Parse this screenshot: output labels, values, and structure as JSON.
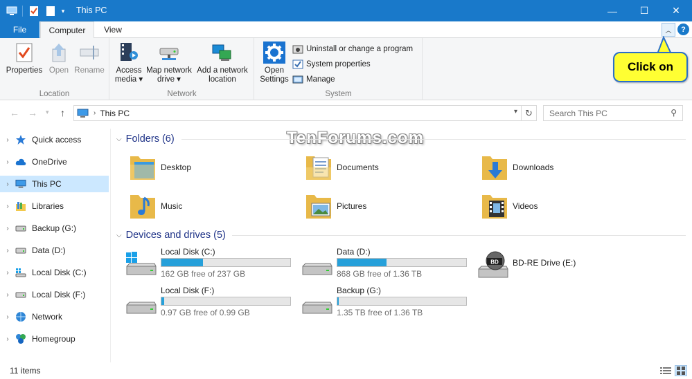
{
  "window": {
    "title": "This PC",
    "minimize_glyph": "—",
    "maximize_glyph": "☐",
    "close_glyph": "✕"
  },
  "ribbon_tabs": {
    "file": "File",
    "computer": "Computer",
    "view": "View"
  },
  "ribbon": {
    "location": {
      "label": "Location",
      "properties": "Properties",
      "open": "Open",
      "rename": "Rename"
    },
    "network": {
      "label": "Network",
      "access_media_line1": "Access",
      "access_media_line2": "media ▾",
      "map_drive_line1": "Map network",
      "map_drive_line2": "drive ▾",
      "add_location_line1": "Add a network",
      "add_location_line2": "location"
    },
    "system": {
      "label": "System",
      "open_settings_line1": "Open",
      "open_settings_line2": "Settings",
      "uninstall": "Uninstall or change a program",
      "system_properties": "System properties",
      "manage": "Manage"
    }
  },
  "callout": {
    "text": "Click on"
  },
  "address": {
    "path": "This PC",
    "search_placeholder": "Search This PC"
  },
  "nav_pane": {
    "items": [
      {
        "label": "Quick access",
        "icon": "star-icon"
      },
      {
        "label": "OneDrive",
        "icon": "cloud-icon"
      },
      {
        "label": "This PC",
        "icon": "computer-icon"
      },
      {
        "label": "Libraries",
        "icon": "libraries-icon"
      },
      {
        "label": "Backup (G:)",
        "icon": "drive-icon"
      },
      {
        "label": "Data (D:)",
        "icon": "drive-icon"
      },
      {
        "label": "Local Disk (C:)",
        "icon": "windows-drive-icon"
      },
      {
        "label": "Local Disk (F:)",
        "icon": "drive-icon"
      },
      {
        "label": "Network",
        "icon": "network-icon"
      },
      {
        "label": "Homegroup",
        "icon": "homegroup-icon"
      }
    ]
  },
  "folders": {
    "header": "Folders (6)",
    "items": [
      {
        "label": "Desktop"
      },
      {
        "label": "Documents"
      },
      {
        "label": "Downloads"
      },
      {
        "label": "Music"
      },
      {
        "label": "Pictures"
      },
      {
        "label": "Videos"
      }
    ]
  },
  "drives": {
    "header": "Devices and drives (5)",
    "items": [
      {
        "name": "Local Disk (C:)",
        "free": "162 GB free of 237 GB",
        "used_fraction": 0.32
      },
      {
        "name": "Data (D:)",
        "free": "868 GB free of 1.36 TB",
        "used_fraction": 0.38
      },
      {
        "name": "BD-RE Drive (E:)"
      },
      {
        "name": "Local Disk (F:)",
        "free": "0.97 GB free of 0.99 GB",
        "used_fraction": 0.02
      },
      {
        "name": "Backup (G:)",
        "free": "1.35 TB free of 1.36 TB",
        "used_fraction": 0.01
      }
    ]
  },
  "watermark": "TenForums.com",
  "status": {
    "count": "11 items"
  },
  "colors": {
    "accent": "#1979ca",
    "selection": "#cce8ff",
    "drive_bar": "#26a0da",
    "callout": "#ffff33"
  }
}
